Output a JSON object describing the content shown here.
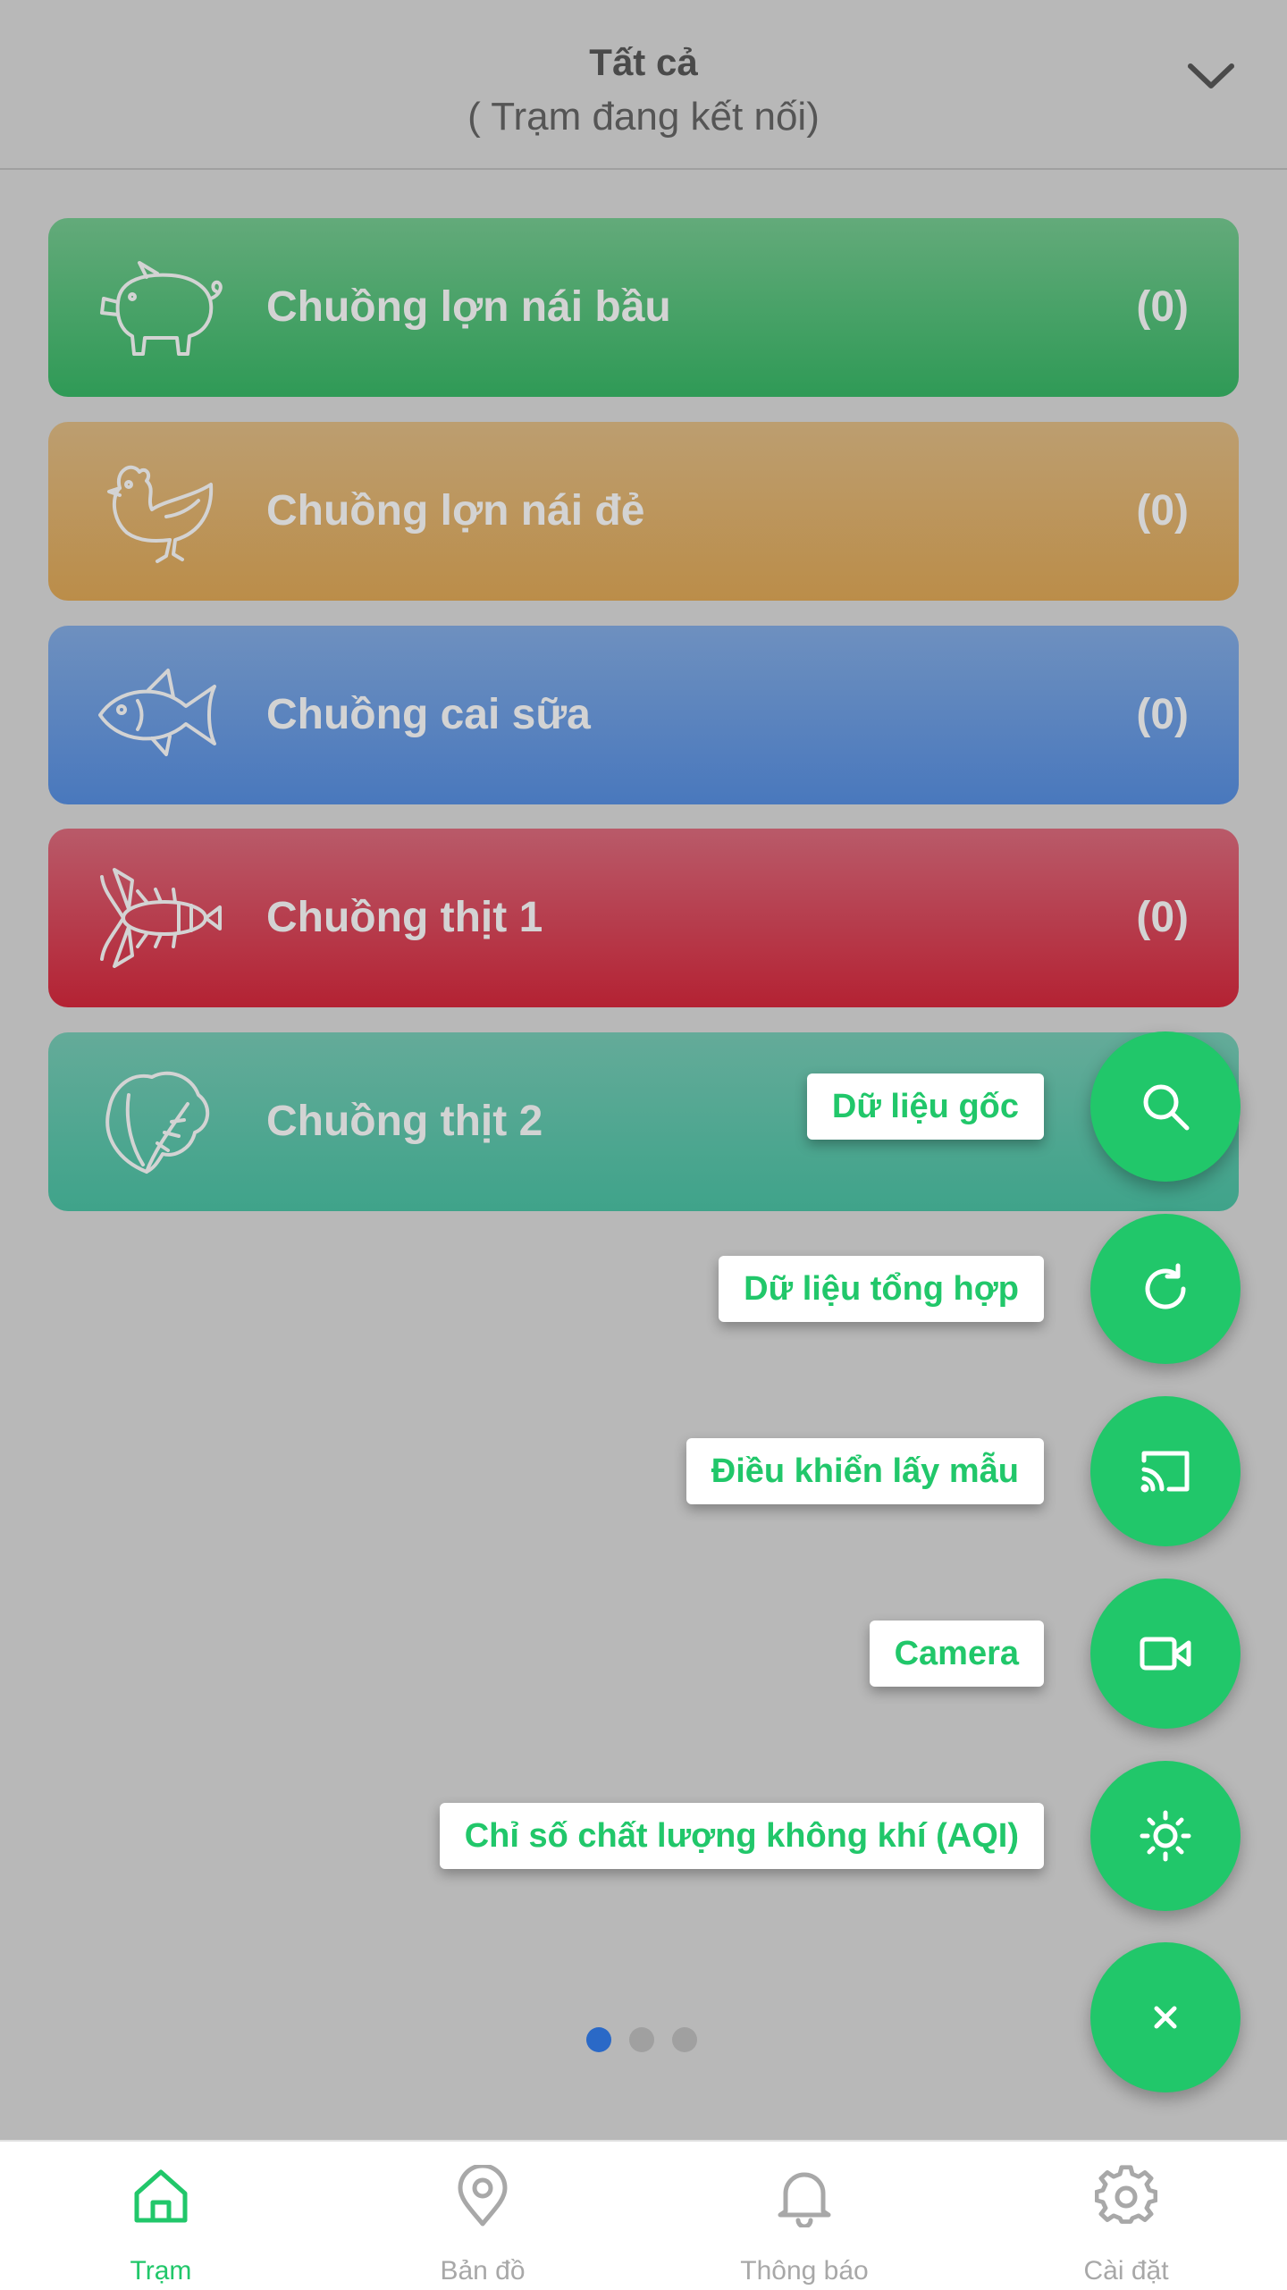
{
  "header": {
    "title": "Tất cả",
    "subtitle": "( Trạm đang kết nối)"
  },
  "stations": [
    {
      "label": "Chuồng lợn nái bầu",
      "count": "(0)",
      "icon": "pig-icon"
    },
    {
      "label": "Chuồng lợn nái đẻ",
      "count": "(0)",
      "icon": "chicken-icon"
    },
    {
      "label": "Chuồng cai sữa",
      "count": "(0)",
      "icon": "fish-icon"
    },
    {
      "label": "Chuồng thịt 1",
      "count": "(0)",
      "icon": "lobster-icon"
    },
    {
      "label": "Chuồng thịt 2",
      "count": "",
      "icon": "lettuce-icon"
    }
  ],
  "fab_menu": [
    {
      "label": "Dữ liệu gốc",
      "icon": "search-icon"
    },
    {
      "label": "Dữ liệu tổng hợp",
      "icon": "refresh-icon"
    },
    {
      "label": "Điều khiển lấy mẫu",
      "icon": "cast-icon"
    },
    {
      "label": "Camera",
      "icon": "video-camera-icon"
    },
    {
      "label": "Chỉ số chất lượng không khí (AQI)",
      "icon": "sun-icon"
    }
  ],
  "fab_close_icon": "close-icon",
  "pagination": {
    "total": 3,
    "active": 1
  },
  "bottom_nav": [
    {
      "label": "Trạm",
      "icon": "home-icon",
      "active": true
    },
    {
      "label": "Bản đồ",
      "icon": "map-pin-icon",
      "active": false
    },
    {
      "label": "Thông báo",
      "icon": "bell-icon",
      "active": false
    },
    {
      "label": "Cài đặt",
      "icon": "gear-icon",
      "active": false
    }
  ],
  "colors": {
    "accent": "#21c76a",
    "overlay": "#b8b8b8",
    "card_green": "#2f9a56",
    "card_orange": "#bb8d49",
    "card_blue": "#4978bd",
    "card_red": "#b42233",
    "card_teal": "#3fa38a",
    "page_dot_active": "#2a69c7"
  }
}
